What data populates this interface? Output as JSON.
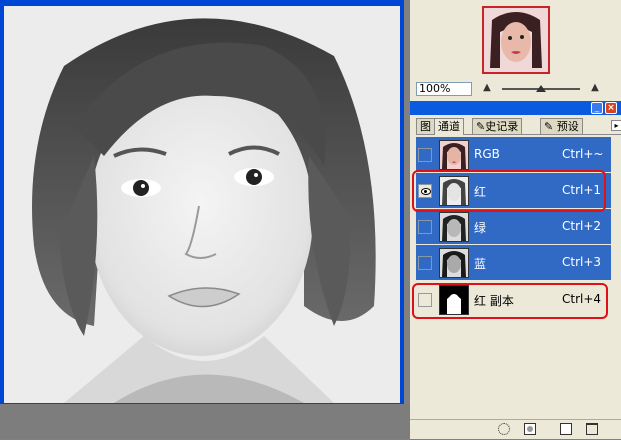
{
  "navigator": {
    "zoom_value": "100%",
    "thumbnail_icon": "photo-thumbnail"
  },
  "palette": {
    "minimize_glyph": "_",
    "close_glyph": "×",
    "tabs": [
      {
        "label": "图"
      },
      {
        "label": "通道"
      },
      {
        "label": "✎史记录"
      },
      {
        "label": "✎ 预设"
      }
    ],
    "menu_glyph": "▸",
    "channels": [
      {
        "name": "RGB",
        "shortcut": "Ctrl+~",
        "visible": false,
        "selected": true,
        "thumbnail": "color"
      },
      {
        "name": "红",
        "shortcut": "Ctrl+1",
        "visible": true,
        "selected": true,
        "thumbnail": "gray"
      },
      {
        "name": "绿",
        "shortcut": "Ctrl+2",
        "visible": false,
        "selected": true,
        "thumbnail": "gray-dark"
      },
      {
        "name": "蓝",
        "shortcut": "Ctrl+3",
        "visible": false,
        "selected": true,
        "thumbnail": "gray-dark"
      },
      {
        "name": "红 副本",
        "shortcut": "Ctrl+4",
        "visible": false,
        "selected": false,
        "thumbnail": "mask"
      }
    ],
    "highlighted_channels": [
      "红",
      "红 副本"
    ],
    "highlight_color": "#e0101a",
    "selection_color": "#316ac5",
    "footer_icons": [
      "load-selection-icon",
      "save-selection-icon",
      "new-channel-icon",
      "delete-channel-icon"
    ]
  },
  "colors": {
    "window_frame": "#0046d5",
    "palette_titlebar": "#0a5be0",
    "panel_bg": "#ece9d8"
  }
}
